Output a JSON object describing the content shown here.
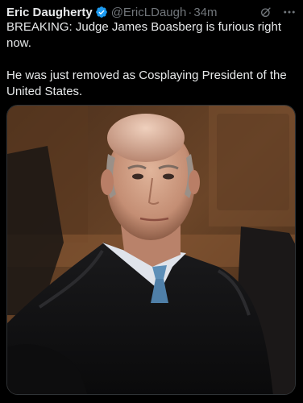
{
  "tweet": {
    "author_name": "Eric Daugherty",
    "handle": "@EricLDaugh",
    "separator": "·",
    "time": "34m",
    "verified_icon": "verified-badge-icon",
    "grok_icon": "grok-icon",
    "more_icon": "more-icon",
    "text_paragraphs": [
      "BREAKING: Judge James Boasberg is furious right now.",
      "He was just removed as Cosplaying President of the United States."
    ]
  },
  "colors": {
    "background": "#000000",
    "text": "#e7e9ea",
    "secondary_text": "#71767b",
    "verified_blue": "#1d9bf0"
  }
}
